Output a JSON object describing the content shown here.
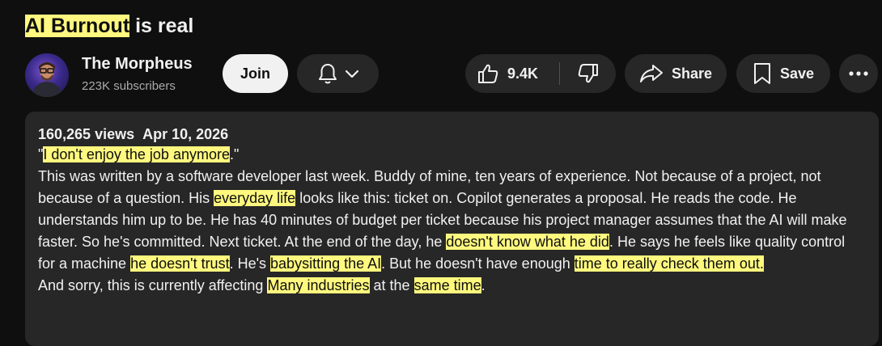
{
  "video": {
    "title_highlight": "AI Burnout",
    "title_rest": " is real"
  },
  "channel": {
    "name": "The Morpheus",
    "subscribers": "223K subscribers"
  },
  "actions": {
    "join_label": "Join",
    "like_count": "9.4K",
    "share_label": "Share",
    "save_label": "Save"
  },
  "description": {
    "views": "160,265 views",
    "date": "Apr 10, 2026",
    "p1": [
      "\"",
      "I don't enjoy the job anymore",
      ".\""
    ],
    "p2": [
      "This was written by a software developer last week. Buddy of mine, ten years of experience. Not because of a project, not because of a question. His ",
      "everyday life",
      " looks like this: ticket on. Copilot generates a proposal. He reads the code. He understands him up to be. He has 40 minutes of budget per ticket because his project manager assumes that the AI will make faster. So he's committed. Next ticket. At the end of the day, he ",
      "doesn't know what he did",
      ". He says he feels like quality control for a machine ",
      "he doesn't trust",
      ". He's ",
      "babysitting the AI",
      ". But he doesn't have enough ",
      "time to really check them out.",
      ""
    ],
    "p3": [
      "And sorry, this is currently affecting ",
      "Many industries",
      " at the ",
      "same time",
      "."
    ]
  },
  "colors": {
    "background": "#0f0f0f",
    "surface": "#272727",
    "highlight": "#fef87e",
    "text": "#f1f1f1",
    "muted": "#aaaaaa"
  }
}
